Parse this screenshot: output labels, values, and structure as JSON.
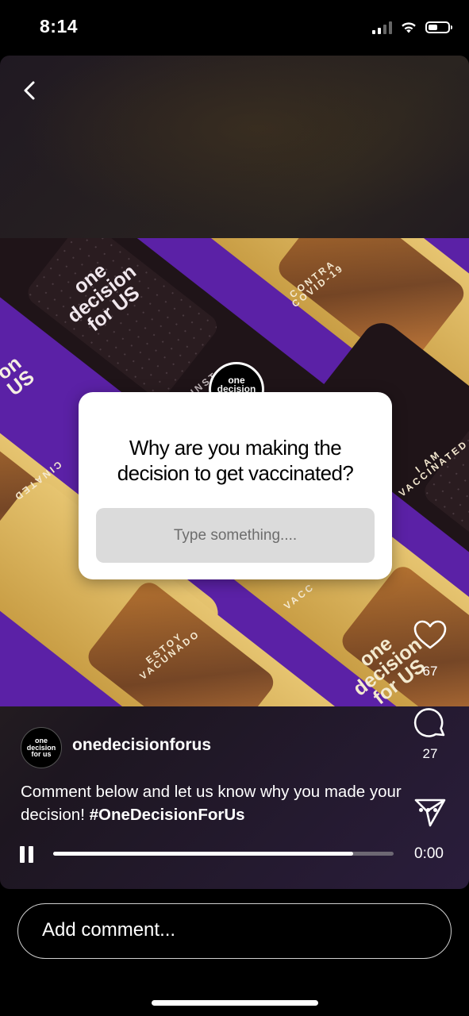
{
  "status_bar": {
    "time": "8:14",
    "icons": [
      "signal-icon",
      "wifi-icon",
      "battery-icon"
    ]
  },
  "reel": {
    "back_icon": "chevron-left-icon",
    "media_texts": {
      "band_1": "one\ndecision\nfor US",
      "band_2": "CONTRA\nCOVID-19",
      "band_3": "on\nUS",
      "band_4": "CINATED",
      "band_5": "I AM\nVACCINATED",
      "band_6": "ESTOY\nVACUNADO",
      "band_7": "one\ndecision\nfor US",
      "band_8": "VACC",
      "band_9": "INST"
    },
    "question_sticker": {
      "avatar_text": "one\ndecision\nfor us",
      "question": "Why are you making the decision to get vaccinated?",
      "input_placeholder": "Type something...."
    },
    "actions": {
      "like": {
        "icon": "heart-icon",
        "count": "67"
      },
      "comment": {
        "icon": "comment-bubble-icon",
        "count": "27"
      },
      "share": {
        "icon": "send-icon"
      },
      "more": {
        "icon": "more-dots-icon"
      }
    },
    "author": {
      "avatar_text": "one\ndecision\nfor us",
      "username": "onedecisionforus"
    },
    "caption": {
      "text": "Comment below and let us know why you made your decision! ",
      "hashtag": "#OneDecisionForUs"
    },
    "playback": {
      "state_icon": "pause-icon",
      "progress_fraction": 0.88,
      "time": "0:00"
    }
  },
  "comment_bar": {
    "placeholder": "Add comment..."
  },
  "colors": {
    "media_background": "#5b21a6",
    "sticker_input": "#dbdbdb",
    "progress_track": "#6d6873"
  }
}
